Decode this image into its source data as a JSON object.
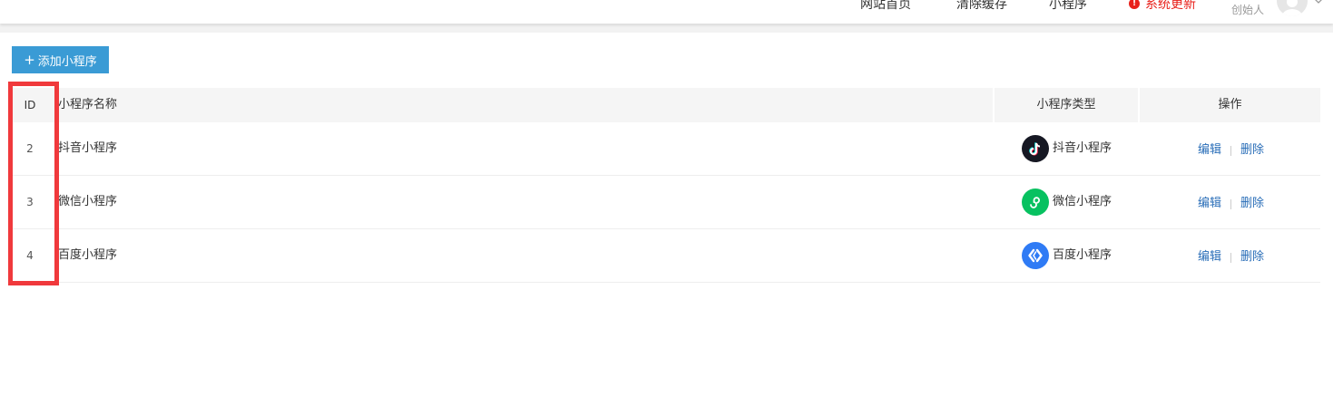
{
  "topnav": {
    "links": [
      "网站首页",
      "清除缓存",
      "小程序"
    ],
    "update_label": "系统更新",
    "user_name": "创始人"
  },
  "toolbar": {
    "add_label": "添加小程序"
  },
  "table": {
    "headers": {
      "id": "ID",
      "name": "小程序名称",
      "type": "小程序类型",
      "ops": "操作"
    },
    "rows": [
      {
        "id": "2",
        "name": "抖音小程序",
        "type": "抖音小程序",
        "icon": "douyin-icon",
        "edit": "编辑",
        "delete": "删除"
      },
      {
        "id": "3",
        "name": "微信小程序",
        "type": "微信小程序",
        "icon": "wechat-miniprogram-icon",
        "edit": "编辑",
        "delete": "删除"
      },
      {
        "id": "4",
        "name": "百度小程序",
        "type": "百度小程序",
        "icon": "baidu-smartprogram-icon",
        "edit": "编辑",
        "delete": "删除"
      }
    ]
  },
  "colors": {
    "accent": "#3a9bd5",
    "link": "#2a6eb8",
    "alert": "#e8201a",
    "highlight": "#f0393c"
  }
}
